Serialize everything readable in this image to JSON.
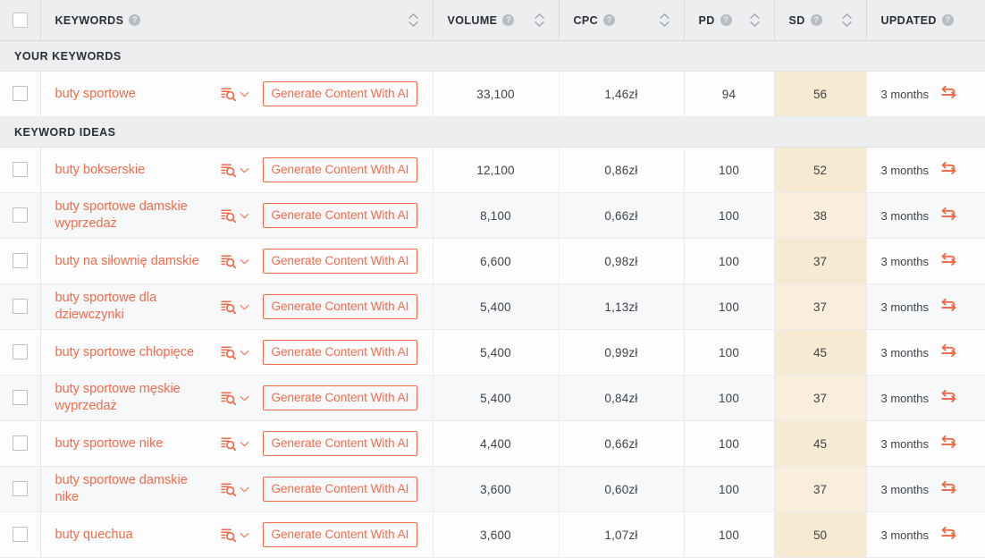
{
  "theme": {
    "accent": "#ef6c4b",
    "header_bg": "#eceef0",
    "row_bg": "#fdfdfd",
    "row_alt_bg": "#f7f8f9",
    "sd_highlight_bg": "#f7ead3",
    "text": "#3d4348"
  },
  "table": {
    "select_all_checkbox": "unchecked",
    "columns": [
      {
        "key": "keywords",
        "label": "KEYWORDS",
        "has_help": true,
        "sortable": true
      },
      {
        "key": "volume",
        "label": "VOLUME",
        "has_help": true,
        "sortable": true
      },
      {
        "key": "cpc",
        "label": "CPC",
        "has_help": true,
        "sortable": true
      },
      {
        "key": "pd",
        "label": "PD",
        "has_help": true,
        "sortable": true
      },
      {
        "key": "sd",
        "label": "SD",
        "has_help": true,
        "sortable": true
      },
      {
        "key": "updated",
        "label": "UPDATED",
        "has_help": true,
        "sortable": false
      }
    ],
    "icons": {
      "help": "help-icon",
      "sort": "sort-arrows-icon",
      "serp_analysis": "serp-search-icon",
      "dropdown": "chevron-down-icon",
      "refresh": "refresh-icon",
      "checkbox": "checkbox-icon"
    },
    "row_action_label": "Generate Content With AI",
    "sections": [
      {
        "id": "your-keywords",
        "title": "YOUR KEYWORDS",
        "rows": [
          {
            "keyword": "buty sportowe",
            "volume": "33,100",
            "cpc": "1,46zł",
            "pd": "94",
            "sd": "56",
            "updated": "3 months"
          }
        ]
      },
      {
        "id": "keyword-ideas",
        "title": "KEYWORD IDEAS",
        "rows": [
          {
            "keyword": "buty bokserskie",
            "volume": "12,100",
            "cpc": "0,86zł",
            "pd": "100",
            "sd": "52",
            "updated": "3 months"
          },
          {
            "keyword": "buty sportowe damskie wyprzedaż",
            "volume": "8,100",
            "cpc": "0,66zł",
            "pd": "100",
            "sd": "38",
            "updated": "3 months"
          },
          {
            "keyword": "buty na siłownię damskie",
            "volume": "6,600",
            "cpc": "0,98zł",
            "pd": "100",
            "sd": "37",
            "updated": "3 months"
          },
          {
            "keyword": "buty sportowe dla dziewczynki",
            "volume": "5,400",
            "cpc": "1,13zł",
            "pd": "100",
            "sd": "37",
            "updated": "3 months"
          },
          {
            "keyword": "buty sportowe chłopięce",
            "volume": "5,400",
            "cpc": "0,99zł",
            "pd": "100",
            "sd": "45",
            "updated": "3 months"
          },
          {
            "keyword": "buty sportowe męskie wyprzedaż",
            "volume": "5,400",
            "cpc": "0,84zł",
            "pd": "100",
            "sd": "37",
            "updated": "3 months"
          },
          {
            "keyword": "buty sportowe nike",
            "volume": "4,400",
            "cpc": "0,66zł",
            "pd": "100",
            "sd": "45",
            "updated": "3 months"
          },
          {
            "keyword": "buty sportowe damskie nike",
            "volume": "3,600",
            "cpc": "0,60zł",
            "pd": "100",
            "sd": "37",
            "updated": "3 months"
          },
          {
            "keyword": "buty quechua",
            "volume": "3,600",
            "cpc": "1,07zł",
            "pd": "100",
            "sd": "50",
            "updated": "3 months"
          }
        ]
      }
    ]
  }
}
